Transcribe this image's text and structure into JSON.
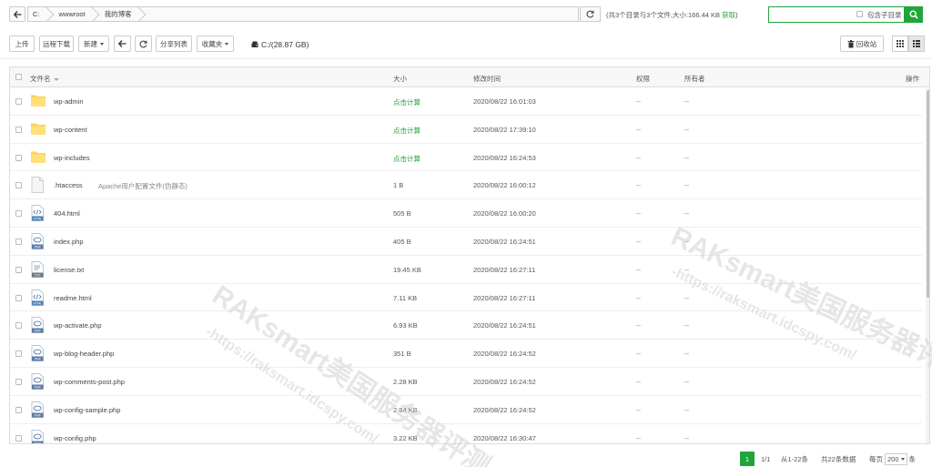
{
  "colors": {
    "accent": "#20a53a",
    "border": "#cccccc"
  },
  "address": {
    "crumbs": [
      "C:",
      "wwwroot",
      "我的博客"
    ],
    "summary_prefix": "(共3个目录与3个文件,大小:166.44 KB",
    "summary_fetch": "获取",
    "summary_suffix": ")",
    "search_value": "",
    "include_subdirs_label": "包含子目录"
  },
  "toolbar": {
    "upload": "上传",
    "remote_download": "远程下载",
    "new": "新建",
    "share_list": "分享列表",
    "favorites": "收藏夹",
    "disk": "C:/(28.87 GB)",
    "recycle_bin": "回收站"
  },
  "table": {
    "headers": {
      "name": "文件名",
      "size": "大小",
      "mtime": "修改时间",
      "perm": "权限",
      "owner": "所有者",
      "ops": "操作"
    },
    "rows": [
      {
        "name": "wp-admin",
        "desc": "",
        "size": "点击计算",
        "time": "2020/08/22 16:01:03",
        "perm": "--",
        "owner": "--",
        "icon": "folder-icon"
      },
      {
        "name": "wp-content",
        "desc": "",
        "size": "点击计算",
        "time": "2020/08/22 17:39:10",
        "perm": "--",
        "owner": "--",
        "icon": "folder-icon"
      },
      {
        "name": "wp-includes",
        "desc": "",
        "size": "点击计算",
        "time": "2020/08/22 16:24:53",
        "perm": "--",
        "owner": "--",
        "icon": "folder-icon"
      },
      {
        "name": ".htaccess",
        "desc": "Apache用户配置文件(伪静态)",
        "size": "1 B",
        "time": "2020/08/22 16:00:12",
        "perm": "--",
        "owner": "--",
        "icon": "blank-file-icon"
      },
      {
        "name": "404.html",
        "desc": "",
        "size": "505 B",
        "time": "2020/08/22 16:00:20",
        "perm": "--",
        "owner": "--",
        "icon": "html-file-icon"
      },
      {
        "name": "index.php",
        "desc": "",
        "size": "405 B",
        "time": "2020/08/22 16:24:51",
        "perm": "--",
        "owner": "--",
        "icon": "php-file-icon"
      },
      {
        "name": "license.txt",
        "desc": "",
        "size": "19.45 KB",
        "time": "2020/08/22 16:27:11",
        "perm": "--",
        "owner": "--",
        "icon": "txt-file-icon"
      },
      {
        "name": "readme.html",
        "desc": "",
        "size": "7.11 KB",
        "time": "2020/08/22 16:27:11",
        "perm": "--",
        "owner": "--",
        "icon": "html-file-icon"
      },
      {
        "name": "wp-activate.php",
        "desc": "",
        "size": "6.93 KB",
        "time": "2020/08/22 16:24:51",
        "perm": "--",
        "owner": "--",
        "icon": "php-file-icon"
      },
      {
        "name": "wp-blog-header.php",
        "desc": "",
        "size": "351 B",
        "time": "2020/08/22 16:24:52",
        "perm": "--",
        "owner": "--",
        "icon": "php-file-icon"
      },
      {
        "name": "wp-comments-post.php",
        "desc": "",
        "size": "2.28 KB",
        "time": "2020/08/22 16:24:52",
        "perm": "--",
        "owner": "--",
        "icon": "php-file-icon"
      },
      {
        "name": "wp-config-sample.php",
        "desc": "",
        "size": "2.84 KB",
        "time": "2020/08/22 16:24:52",
        "perm": "--",
        "owner": "--",
        "icon": "php-file-icon"
      },
      {
        "name": "wp-config.php",
        "desc": "",
        "size": "3.22 KB",
        "time": "2020/08/22 16:30:47",
        "perm": "--",
        "owner": "--",
        "icon": "php-file-icon"
      }
    ]
  },
  "pagination": {
    "current": "1",
    "pages": "1/1",
    "range": "从1-22条",
    "total": "共22条数据",
    "per_page_prefix": "每页",
    "per_page": "200",
    "per_page_suffix": "条"
  },
  "watermark": {
    "brand": "RAKsmart美国服务器评测",
    "url": "-https://raksmart.idcspy.com/"
  }
}
